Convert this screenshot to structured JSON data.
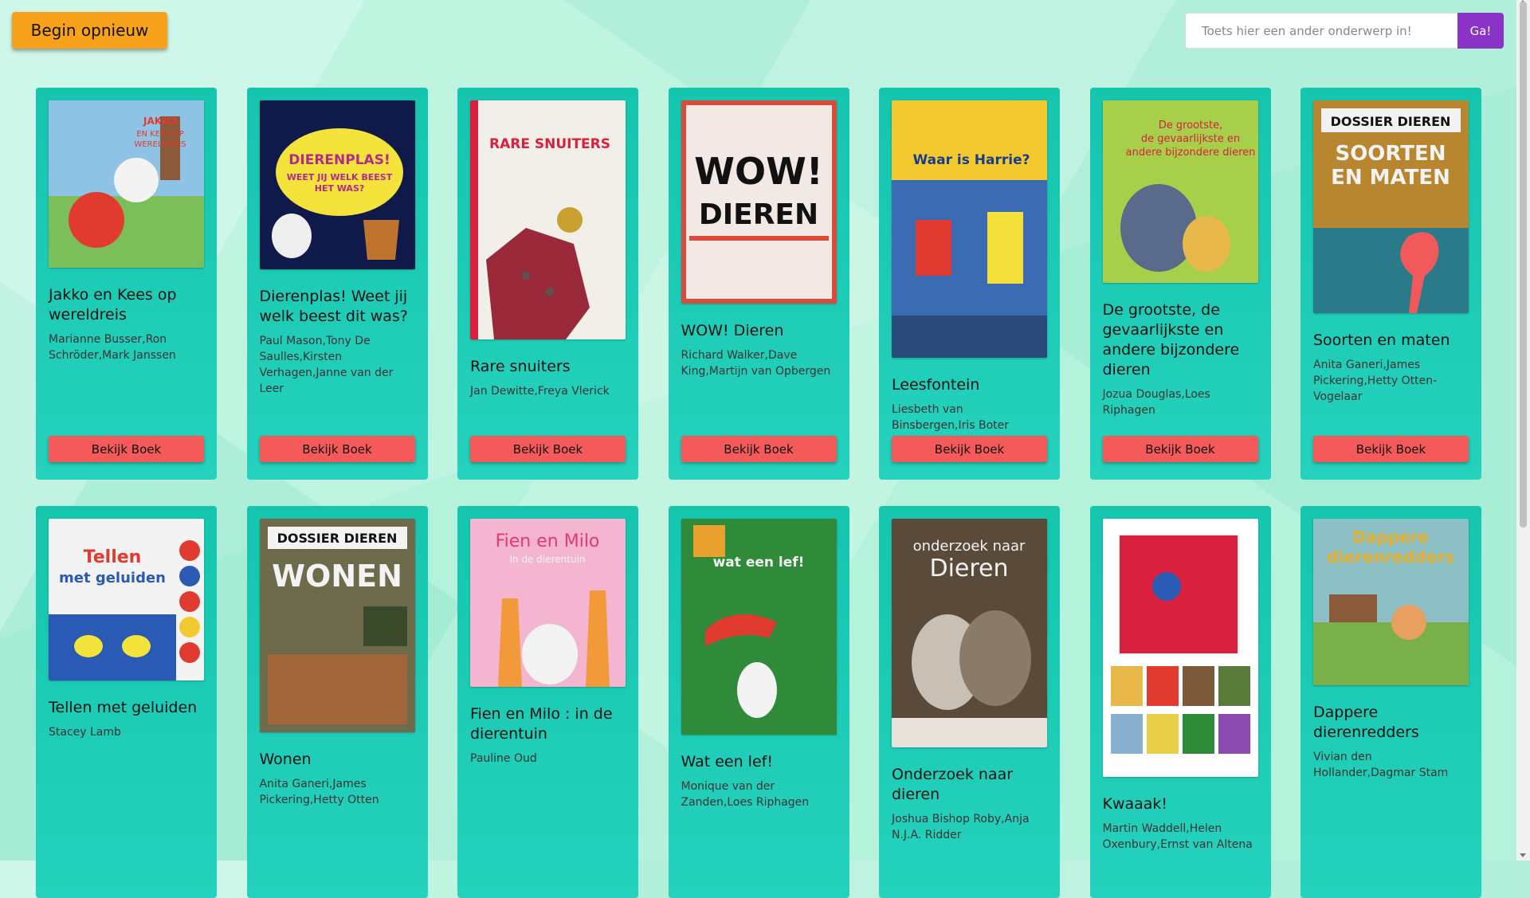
{
  "header": {
    "restart_label": "Begin opnieuw",
    "search_placeholder": "Toets hier een ander onderwerp in!",
    "search_value": "",
    "go_label": "Ga!"
  },
  "accent_colors": {
    "restart": "#f7a21a",
    "go": "#8b32c8",
    "card": "#1ccab4",
    "view_button": "#f45a5a"
  },
  "books": [
    {
      "title": "Jakko en Kees op wereldreis",
      "authors": "Marianne Busser,Ron Schröder,Mark Janssen",
      "button": "Bekijk Boek",
      "cover_text": "JAKKO EN KEES OP WERELDREIS",
      "cover_color": "#8fc3e6"
    },
    {
      "title": "Dierenplas! Weet jij welk beest dit was?",
      "authors": "Paul Mason,Tony De Saulles,Kirsten Verhagen,Janne van der Leer",
      "button": "Bekijk Boek",
      "cover_text": "DIERENPLAS! WEET JIJ WELK BEEST HET WAS?",
      "cover_color": "#101a4a"
    },
    {
      "title": "Rare snuiters",
      "authors": "Jan Dewitte,Freya Vlerick",
      "button": "Bekijk Boek",
      "cover_text": "RARE SNUITERS",
      "cover_color": "#f2efe9"
    },
    {
      "title": "WOW! Dieren",
      "authors": "Richard Walker,Dave King,Martijn van Opbergen",
      "button": "Bekijk Boek",
      "cover_text": "WOW! DIEREN",
      "cover_color": "#d94b3a"
    },
    {
      "title": "Leesfontein",
      "authors": "Liesbeth van Binsbergen,Iris Boter",
      "button": "Bekijk Boek",
      "cover_text": "Waar is Harrie?",
      "cover_color": "#f2c92e"
    },
    {
      "title": "De grootste, de gevaarlijkste en andere bijzondere dieren",
      "authors": "Jozua Douglas,Loes Riphagen",
      "button": "Bekijk Boek",
      "cover_text": "De grootste, de gevaarlijkste en andere bijzondere dieren",
      "cover_color": "#a7cf4a"
    },
    {
      "title": "Soorten en maten",
      "authors": "Anita Ganeri,James Pickering,Hetty Otten-Vogelaar",
      "button": "Bekijk Boek",
      "cover_text": "DOSSIER DIEREN",
      "cover_color": "#b8862e"
    },
    {
      "title": "Tellen met geluiden",
      "authors": "Stacey Lamb",
      "button": "",
      "cover_text": "Tellen met geluiden",
      "cover_color": "#f3f3f3"
    },
    {
      "title": "Wonen",
      "authors": "Anita Ganeri,James Pickering,Hetty Otten",
      "button": "",
      "cover_text": "DOSSIER DIEREN WONEN",
      "cover_color": "#6e6a4c"
    },
    {
      "title": "Fien en Milo : in de dierentuin",
      "authors": "Pauline Oud",
      "button": "",
      "cover_text": "Fien en Milo In de dierentuin",
      "cover_color": "#f4b5d0"
    },
    {
      "title": "Wat een lef!",
      "authors": "Monique van der Zanden,Loes Riphagen",
      "button": "",
      "cover_text": "wat een lef!",
      "cover_color": "#2f8a3a"
    },
    {
      "title": "Onderzoek naar dieren",
      "authors": "Joshua Bishop Roby,Anja N.J.A. Ridder",
      "button": "",
      "cover_text": "onderzoek naar Dieren",
      "cover_color": "#5a4a3a"
    },
    {
      "title": "Kwaaak!",
      "authors": "Martin Waddell,Helen Oxenbury,Ernst van Altena",
      "button": "",
      "cover_text": "",
      "cover_color": "#ffffff"
    },
    {
      "title": "Dappere dierenredders",
      "authors": "Vivian den Hollander,Dagmar Stam",
      "button": "",
      "cover_text": "Dappere dierenredders",
      "cover_color": "#8cc0c4"
    }
  ]
}
